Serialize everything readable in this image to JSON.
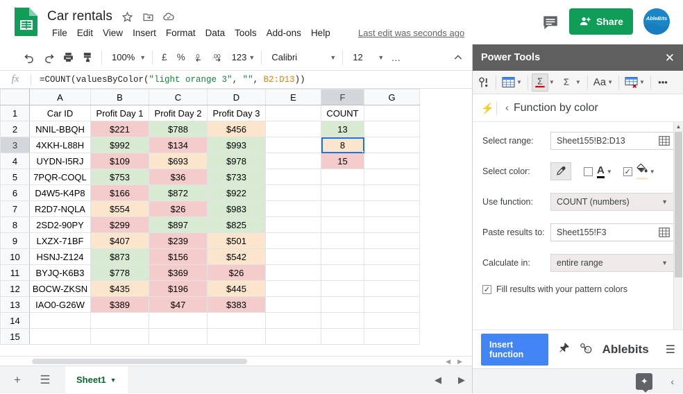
{
  "header": {
    "doc_title": "Car rentals",
    "title_icons": [
      {
        "name": "star-icon",
        "glyph": "☆"
      },
      {
        "name": "move-to-folder-icon",
        "glyph": "▣"
      },
      {
        "name": "cloud-saved-icon",
        "glyph": "☁"
      }
    ],
    "menus": [
      "File",
      "Edit",
      "View",
      "Insert",
      "Format",
      "Data",
      "Tools",
      "Add-ons",
      "Help"
    ],
    "last_edit": "Last edit was seconds ago",
    "comment_icon": "comment-icon",
    "share_label": "Share",
    "avatar_label": "AbleBits"
  },
  "toolbar": {
    "zoom": "100%",
    "font": "Calibri",
    "font_size": "12",
    "currency_symbol": "£",
    "percent_symbol": "%",
    "decrease_decimal": ".0",
    "increase_decimal": ".00",
    "number_format": "123",
    "more_label": "…"
  },
  "formula_bar": {
    "fx_label": "fx",
    "prefix": "=COUNT(valuesByColor(",
    "string_arg1": "\"light orange 3\"",
    "comma1": ", ",
    "string_arg2": "\"\"",
    "comma2": ", ",
    "range_ref": "B2:D13",
    "suffix": "))"
  },
  "grid": {
    "columns": [
      "A",
      "B",
      "C",
      "D",
      "E",
      "F",
      "G"
    ],
    "active_column": "F",
    "active_row": "3",
    "rows": [
      "1",
      "2",
      "3",
      "4",
      "5",
      "6",
      "7",
      "8",
      "9",
      "10",
      "11",
      "12",
      "13",
      "14",
      "15"
    ],
    "headers": {
      "A": "Car ID",
      "B": "Profit Day 1",
      "C": "Profit Day 2",
      "D": "Profit Day 3",
      "F": "COUNT"
    },
    "data": [
      {
        "row": "2",
        "a": "NNIL-BBQH",
        "b": "$221",
        "bc": "red",
        "c": "$788",
        "cc": "green",
        "d": "$456",
        "dc": "orange"
      },
      {
        "row": "3",
        "a": "4XKH-L88H",
        "b": "$992",
        "bc": "green",
        "c": "$134",
        "cc": "red",
        "d": "$993",
        "dc": "green"
      },
      {
        "row": "4",
        "a": "UYDN-I5RJ",
        "b": "$109",
        "bc": "red",
        "c": "$693",
        "cc": "orange",
        "d": "$978",
        "dc": "green"
      },
      {
        "row": "5",
        "a": "7PQR-COQL",
        "b": "$753",
        "bc": "green",
        "c": "$36",
        "cc": "red",
        "d": "$733",
        "dc": "green"
      },
      {
        "row": "6",
        "a": "D4W5-K4P8",
        "b": "$166",
        "bc": "red",
        "c": "$872",
        "cc": "green",
        "d": "$922",
        "dc": "green"
      },
      {
        "row": "7",
        "a": "R2D7-NQLA",
        "b": "$554",
        "bc": "orange",
        "c": "$26",
        "cc": "red",
        "d": "$983",
        "dc": "green"
      },
      {
        "row": "8",
        "a": "2SD2-90PY",
        "b": "$299",
        "bc": "red",
        "c": "$897",
        "cc": "green",
        "d": "$825",
        "dc": "green"
      },
      {
        "row": "9",
        "a": "LXZX-71BF",
        "b": "$407",
        "bc": "orange",
        "c": "$239",
        "cc": "red",
        "d": "$501",
        "dc": "orange"
      },
      {
        "row": "10",
        "a": "HSNJ-Z124",
        "b": "$873",
        "bc": "green",
        "c": "$156",
        "cc": "red",
        "d": "$542",
        "dc": "orange"
      },
      {
        "row": "11",
        "a": "BYJQ-K6B3",
        "b": "$778",
        "bc": "green",
        "c": "$369",
        "cc": "red",
        "d": "$26",
        "dc": "red"
      },
      {
        "row": "12",
        "a": "BOCW-ZKSN",
        "b": "$435",
        "bc": "orange",
        "c": "$196",
        "cc": "red",
        "d": "$445",
        "dc": "orange"
      },
      {
        "row": "13",
        "a": "IAO0-G26W",
        "b": "$389",
        "bc": "red",
        "c": "$47",
        "cc": "red",
        "d": "$383",
        "dc": "red"
      }
    ],
    "count_results": [
      {
        "row": "2",
        "value": "13",
        "color": "green",
        "selected": false
      },
      {
        "row": "3",
        "value": "8",
        "color": "orange",
        "selected": true
      },
      {
        "row": "4",
        "value": "15",
        "color": "red",
        "selected": false
      }
    ],
    "fill_colors": {
      "red": "#f4cccc",
      "green": "#d9ead3",
      "orange": "#fce5cd",
      "none": "#ffffff"
    }
  },
  "sheet_tabs": {
    "add_label": "+",
    "all_sheets_label": "☰",
    "tabs": [
      "Sheet1"
    ],
    "active_tab": "Sheet1",
    "nav_prev": "◀",
    "nav_next": "▶"
  },
  "panel": {
    "title": "Power Tools",
    "close_label": "✕",
    "tools": [
      {
        "name": "smart-toolbar-icon",
        "label": "፧"
      },
      {
        "name": "table-tools-icon",
        "label": "▦"
      },
      {
        "name": "sum-by-color-icon",
        "label": "Σ"
      },
      {
        "name": "sum-icon",
        "label": "Σ"
      },
      {
        "name": "text-tools-icon",
        "label": "Aa"
      },
      {
        "name": "clear-tools-icon",
        "label": "▦"
      },
      {
        "name": "more-tools-icon",
        "label": "•••"
      }
    ],
    "breadcrumb_back": "‹",
    "breadcrumb_title": "Function by color",
    "fields": {
      "select_range_label": "Select range:",
      "select_range_value": "Sheet155!B2:D13",
      "select_color_label": "Select color:",
      "font_color_checked": false,
      "fill_color_checked": true,
      "fill_color_swatch": "#fce5cd",
      "use_function_label": "Use function:",
      "use_function_value": "COUNT (numbers)",
      "paste_results_label": "Paste results to:",
      "paste_results_value": "Sheet155!F3",
      "calculate_in_label": "Calculate in:",
      "calculate_in_value": "entire range",
      "fill_pattern_label": "Fill results with your pattern colors",
      "fill_pattern_checked": true
    },
    "footer": {
      "insert_label": "Insert function",
      "pin_icon": "pin-icon",
      "help_icon": "help-icon",
      "brand": "Ablebits",
      "menu_icon": "hamburger-icon"
    },
    "collapse_up": "∧",
    "explore_icon": "explore-icon",
    "collapse_chevron": "‹"
  }
}
